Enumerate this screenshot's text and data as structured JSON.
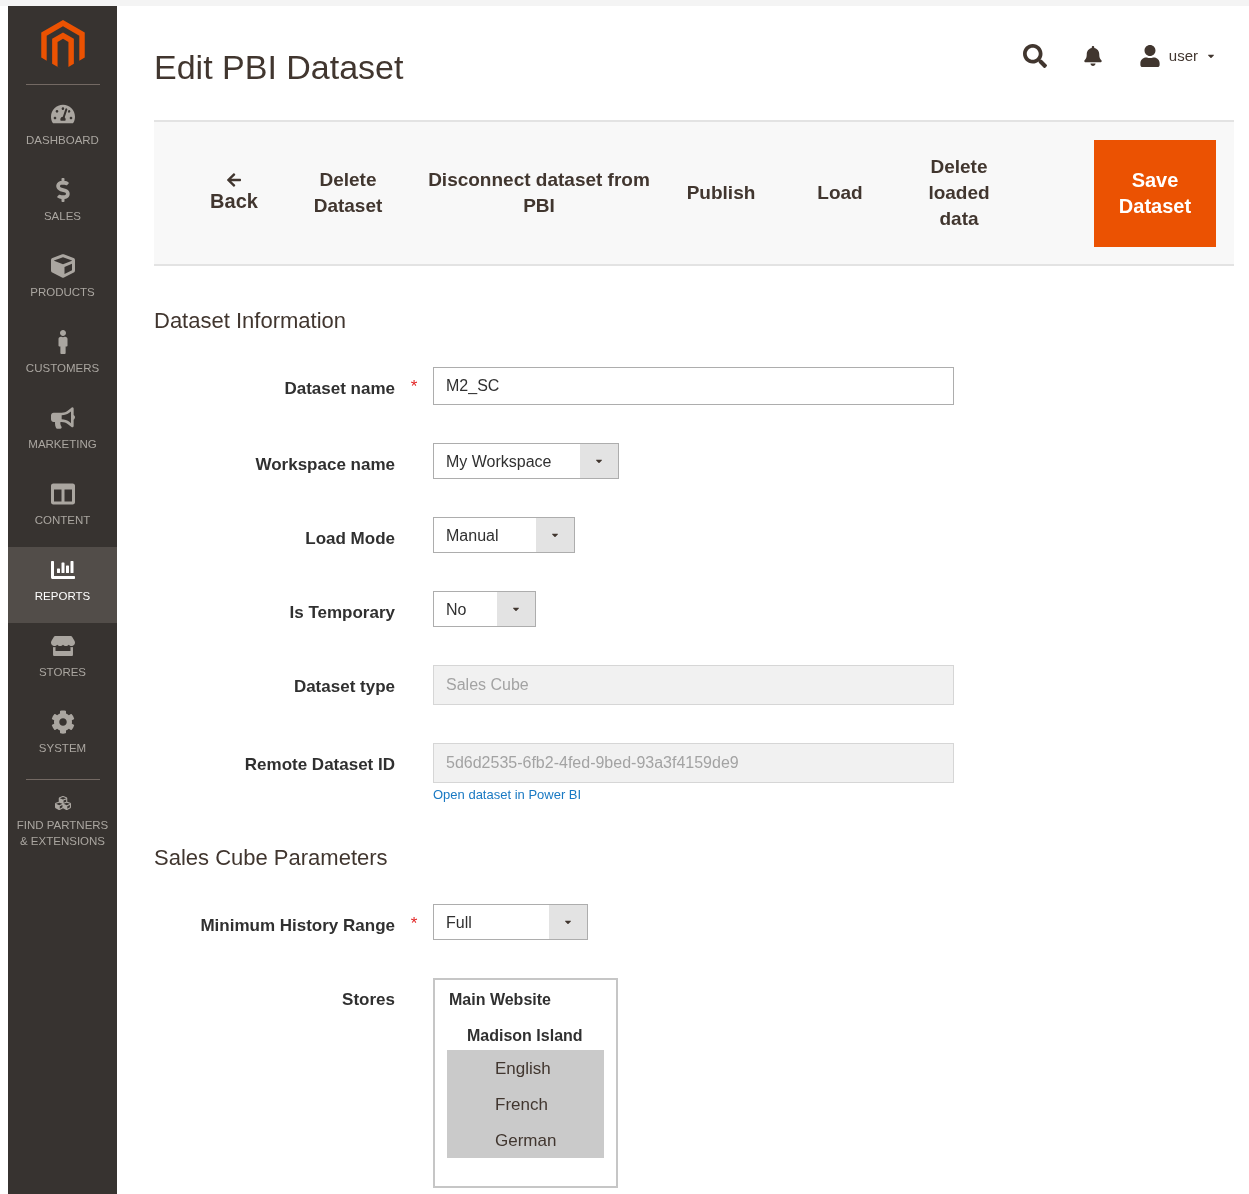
{
  "sidebar": {
    "items": [
      {
        "label": "DASHBOARD",
        "selected": false
      },
      {
        "label": "SALES",
        "selected": false
      },
      {
        "label": "PRODUCTS",
        "selected": false
      },
      {
        "label": "CUSTOMERS",
        "selected": false
      },
      {
        "label": "MARKETING",
        "selected": false
      },
      {
        "label": "CONTENT",
        "selected": false
      },
      {
        "label": "REPORTS",
        "selected": true
      },
      {
        "label": "STORES",
        "selected": false
      },
      {
        "label": "SYSTEM",
        "selected": false
      },
      {
        "label": "FIND PARTNERS & EXTENSIONS",
        "selected": false
      }
    ]
  },
  "header": {
    "title": "Edit PBI Dataset",
    "user": "user"
  },
  "toolbar": {
    "buttons": [
      {
        "label": "Back",
        "kind": "back"
      },
      {
        "label": "Delete Dataset",
        "kind": "plain"
      },
      {
        "label": "Disconnect dataset from PBI",
        "kind": "plain"
      },
      {
        "label": "Publish",
        "kind": "plain"
      },
      {
        "label": "Load",
        "kind": "plain"
      },
      {
        "label": "Delete loaded data",
        "kind": "plain"
      },
      {
        "label": "Save Dataset",
        "kind": "primary"
      }
    ]
  },
  "sections": [
    {
      "title": "Dataset Information",
      "fields": [
        {
          "label": "Dataset name",
          "kind": "text",
          "required_mark": "*",
          "value": "M2_SC"
        },
        {
          "label": "Workspace name",
          "kind": "select",
          "value": "My Workspace"
        },
        {
          "label": "Load Mode",
          "kind": "select",
          "value": "Manual"
        },
        {
          "label": "Is Temporary",
          "kind": "select",
          "value": "No"
        },
        {
          "label": "Dataset type",
          "kind": "disabled",
          "value": "Sales Cube"
        },
        {
          "label": "Remote Dataset ID",
          "kind": "disabled",
          "value": "5d6d2535-6fb2-4fed-9bed-93a3f4159de9",
          "link": "Open dataset in Power BI"
        }
      ]
    },
    {
      "title": "Sales Cube Parameters",
      "fields": [
        {
          "label": "Minimum History Range",
          "kind": "select",
          "required_mark": "*",
          "value": "Full"
        },
        {
          "label": "Stores",
          "kind": "multiselect",
          "website": "Main Website",
          "store": "Madison Island",
          "options": [
            {
              "label": "English",
              "selected": true
            },
            {
              "label": "French",
              "selected": true
            },
            {
              "label": "German",
              "selected": true
            }
          ]
        }
      ]
    }
  ]
}
